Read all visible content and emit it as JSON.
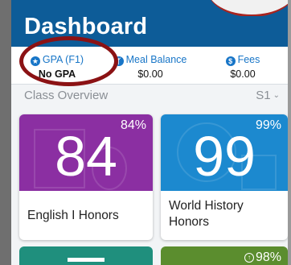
{
  "header": {
    "title": "Dashboard"
  },
  "stats": {
    "gpa": {
      "label": "GPA (F1)",
      "value": "No GPA",
      "icon": "star-icon"
    },
    "meal": {
      "label": "Meal Balance",
      "value": "$0.00",
      "icon": "utensils-icon"
    },
    "fees": {
      "label": "Fees",
      "value": "$0.00",
      "icon": "dollar-icon"
    }
  },
  "class_overview": {
    "title": "Class Overview",
    "term": "S1"
  },
  "courses": [
    {
      "name": "English I Honors",
      "grade": "84",
      "percent": "84%",
      "color": "#8b2fa2"
    },
    {
      "name": "World History Honors",
      "grade": "99",
      "percent": "99%",
      "color": "#1c89cf"
    },
    {
      "name": "",
      "grade": "",
      "percent": "",
      "color": "#1f8f7d"
    },
    {
      "name": "",
      "grade": "",
      "percent": "98%",
      "color": "#5b8d2e"
    }
  ],
  "colors": {
    "header": "#0d5c98",
    "accent": "#1775c7",
    "highlight_ring": "#8b1214"
  }
}
